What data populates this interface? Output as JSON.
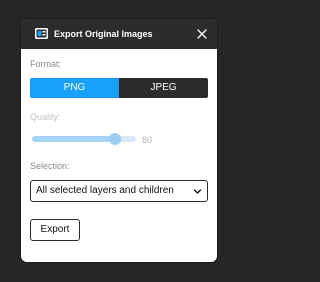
{
  "dialog": {
    "title": "Export Original Images",
    "app_icon": "app-logo-icon",
    "close_icon": "close-icon"
  },
  "format": {
    "label": "Format:",
    "options": [
      "PNG",
      "JPEG"
    ],
    "selected": "PNG"
  },
  "quality": {
    "label": "Quality:",
    "value": "80",
    "fraction": 0.8
  },
  "selection": {
    "label": "Selection:",
    "value": "All selected layers and children"
  },
  "actions": {
    "export_label": "Export"
  },
  "colors": {
    "accent": "#18a0fb",
    "dark": "#2c2c2c",
    "background": "#262626"
  }
}
